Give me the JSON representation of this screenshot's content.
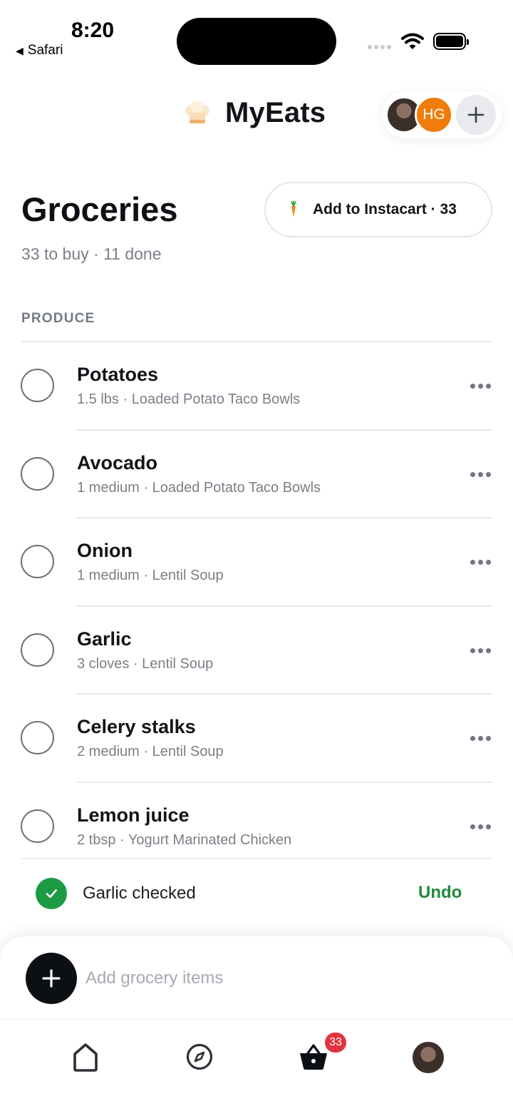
{
  "status_bar": {
    "time": "8:20",
    "back_app": "Safari"
  },
  "header": {
    "brand_name": "MyEats",
    "avatar_initials": "HG"
  },
  "page": {
    "title": "Groceries",
    "subtitle": "33 to buy · 11 done",
    "instacart_label": "Add to Instacart · 33"
  },
  "section": {
    "title": "PRODUCE"
  },
  "items": [
    {
      "name": "Potatoes",
      "meta": "1.5 lbs · Loaded Potato Taco Bowls"
    },
    {
      "name": "Avocado",
      "meta": "1 medium · Loaded Potato Taco Bowls"
    },
    {
      "name": "Onion",
      "meta": "1 medium · Lentil Soup"
    },
    {
      "name": "Garlic",
      "meta": "3 cloves · Lentil Soup"
    },
    {
      "name": "Celery stalks",
      "meta": "2 medium · Lentil Soup"
    },
    {
      "name": "Lemon juice",
      "meta": "2 tbsp · Yogurt Marinated Chicken"
    }
  ],
  "toast": {
    "text": "Garlic checked",
    "undo_label": "Undo"
  },
  "composer": {
    "placeholder": "Add grocery items"
  },
  "tabbar": {
    "cart_badge": "33"
  },
  "colors": {
    "accent_green": "#1d9a44",
    "badge_red": "#e2323e",
    "avatar_orange": "#f07c0c"
  },
  "icons": [
    "chef-hat-icon",
    "plus-icon",
    "carrot-icon",
    "more-icon",
    "check-icon",
    "home-icon",
    "compass-icon",
    "basket-icon"
  ]
}
